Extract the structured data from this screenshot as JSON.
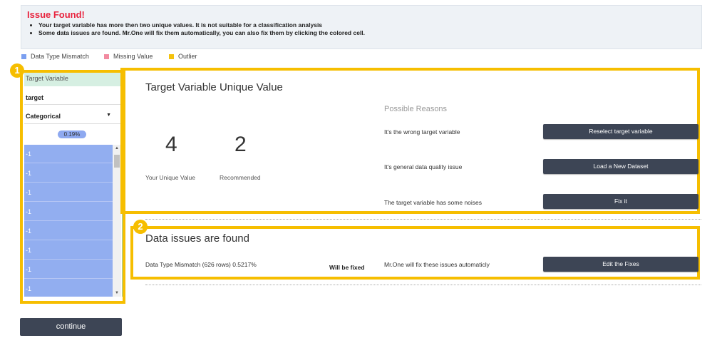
{
  "alert": {
    "title": "Issue Found!",
    "items": [
      "Your target variable has more then two unique values. It is not suitable for a classification analysis",
      "Some data issues are found. Mr.One will fix them automatically, you can also fix them by clicking the colored cell."
    ]
  },
  "legend": [
    {
      "label": "Data Type Mismatch",
      "color": "#7b9ff0"
    },
    {
      "label": "Missing Value",
      "color": "#f28ba0"
    },
    {
      "label": "Outlier",
      "color": "#f4c20d"
    }
  ],
  "left": {
    "header": "Target Variable",
    "target_value": "target",
    "type_selected": "Categorical",
    "pill": "0.19%",
    "cells": [
      "-1",
      "-1",
      "-1",
      "-1",
      "-1",
      "-1",
      "-1",
      "-1"
    ]
  },
  "badges": {
    "one": "1",
    "two": "2"
  },
  "target_panel": {
    "title": "Target Variable Unique Value",
    "your_value": "4",
    "your_label": "Your Unique Value",
    "recommended_value": "2",
    "recommended_label": "Recommended",
    "reasons_title": "Possible Reasons",
    "reasons": [
      {
        "text": "It's the wrong target variable",
        "button": "Reselect target variable"
      },
      {
        "text": "It's general data quality issue",
        "button": "Load a New Dataset"
      },
      {
        "text": "The target variable has some noises",
        "button": "Fix it"
      }
    ]
  },
  "issues_panel": {
    "title": "Data issues are found",
    "issue": "Data Type Mismatch (626 rows) 0.5217%",
    "status": "Will be fixed",
    "note": "Mr.One will fix these issues automaticly",
    "button": "Edit the Fixes"
  },
  "continue_label": "continue"
}
